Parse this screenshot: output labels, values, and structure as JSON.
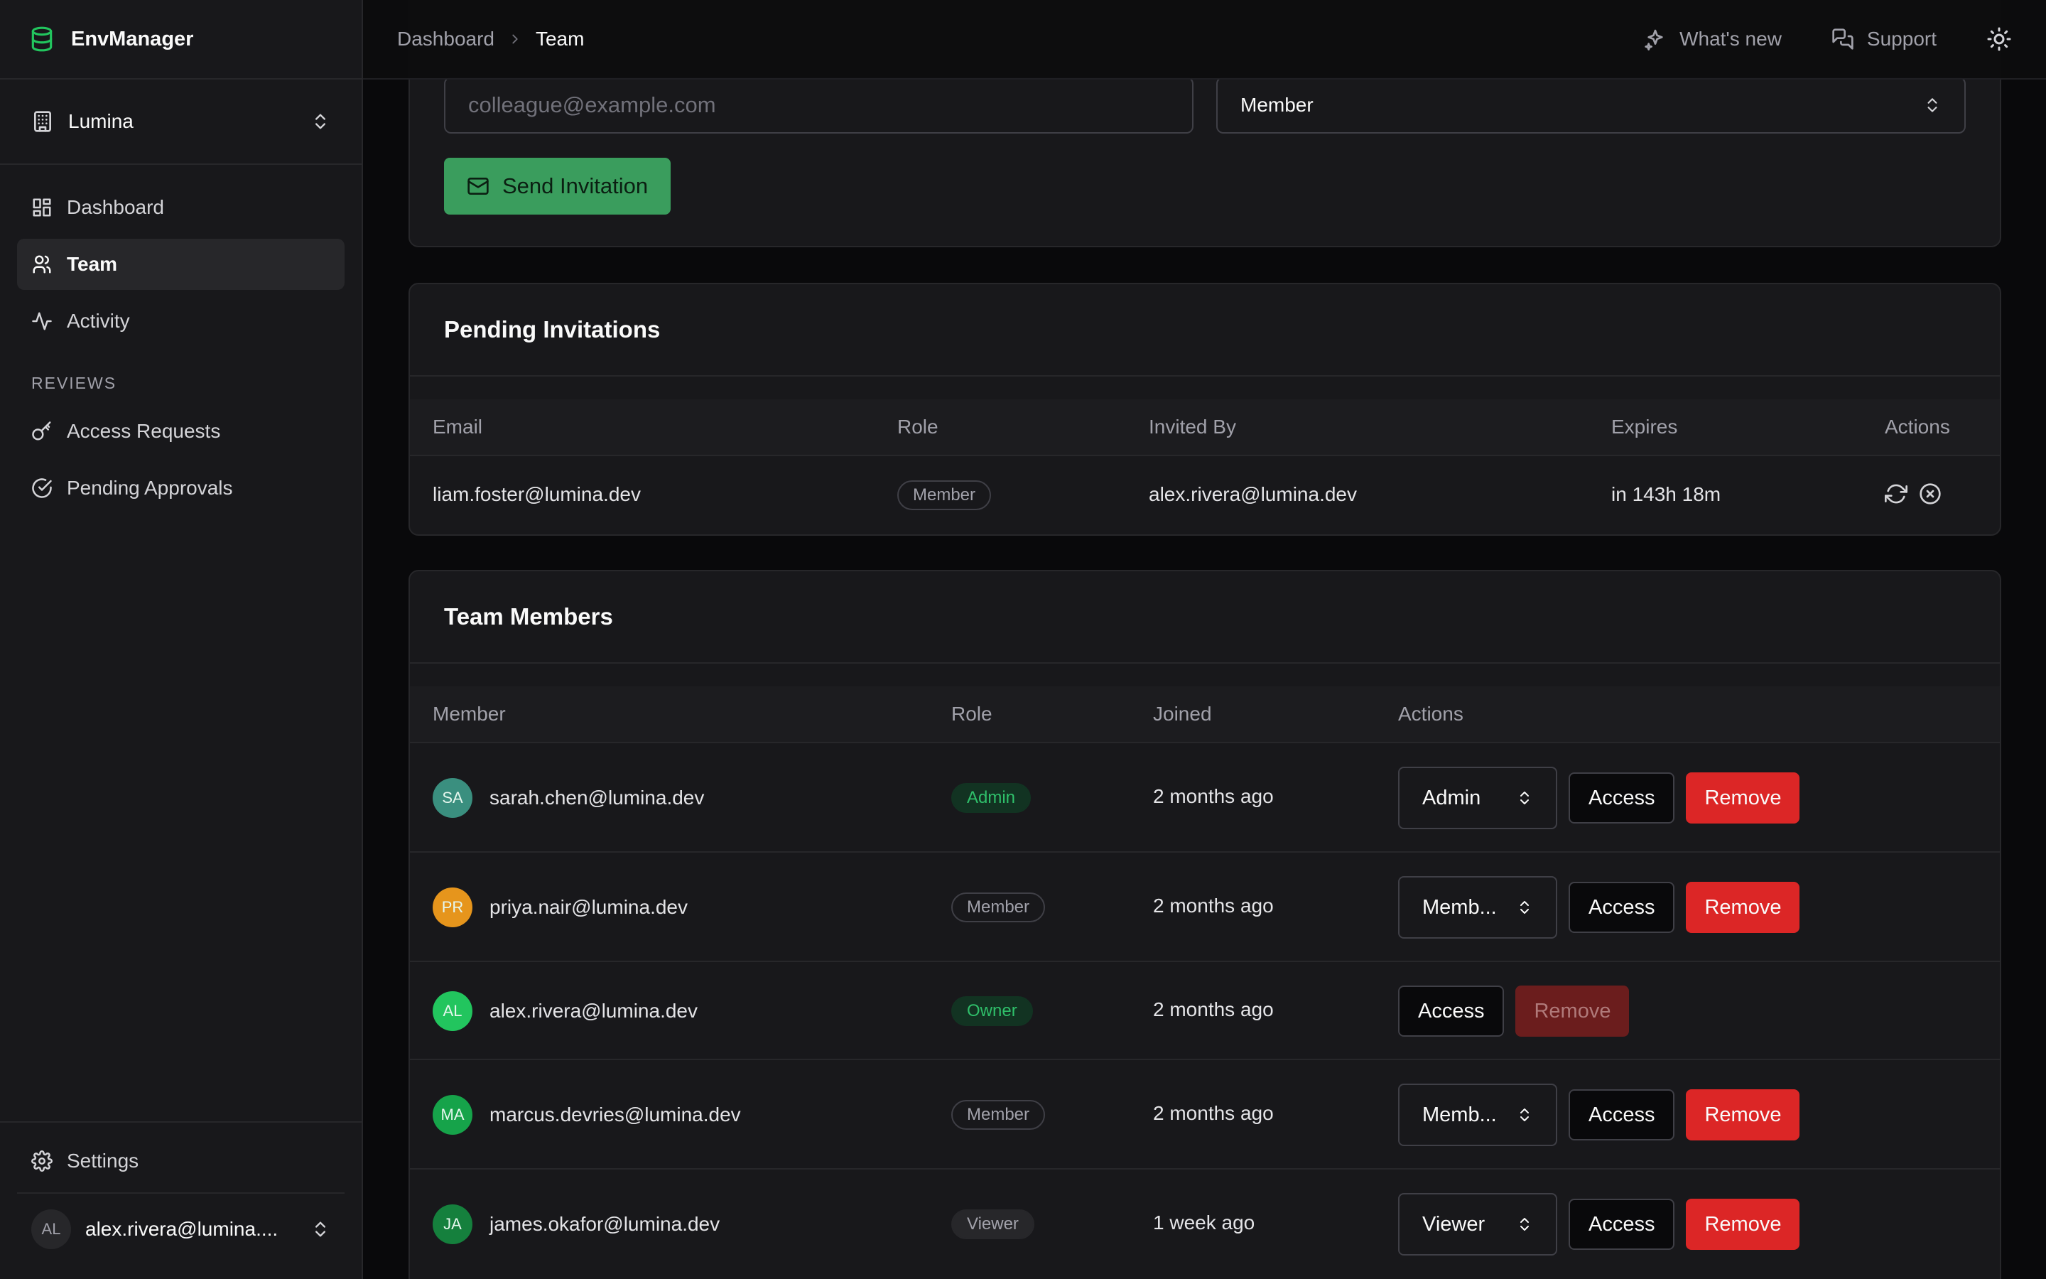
{
  "app": {
    "name": "EnvManager"
  },
  "org": {
    "name": "Lumina"
  },
  "nav": {
    "items": [
      {
        "label": "Dashboard",
        "icon": "dashboard-icon"
      },
      {
        "label": "Team",
        "icon": "users-icon",
        "active": true
      },
      {
        "label": "Activity",
        "icon": "activity-icon"
      }
    ],
    "section_label": "REVIEWS",
    "review_items": [
      {
        "label": "Access Requests",
        "icon": "key-icon"
      },
      {
        "label": "Pending Approvals",
        "icon": "check-circle-icon"
      }
    ],
    "settings_label": "Settings"
  },
  "user": {
    "initials": "AL",
    "email": "alex.rivera@lumina...."
  },
  "topbar": {
    "breadcrumb": [
      "Dashboard",
      "Team"
    ],
    "whats_new": "What's new",
    "support": "Support"
  },
  "invite": {
    "email_placeholder": "colleague@example.com",
    "role_value": "Member",
    "send_label": "Send Invitation"
  },
  "pending": {
    "title": "Pending Invitations",
    "columns": [
      "Email",
      "Role",
      "Invited By",
      "Expires",
      "Actions"
    ],
    "rows": [
      {
        "email": "liam.foster@lumina.dev",
        "role": "Member",
        "invited_by": "alex.rivera@lumina.dev",
        "expires": "in 143h 18m"
      }
    ]
  },
  "members": {
    "title": "Team Members",
    "columns": [
      "Member",
      "Role",
      "Joined",
      "Actions"
    ],
    "rows": [
      {
        "initials": "SA",
        "email": "sarah.chen@lumina.dev",
        "role": "Admin",
        "joined": "2 months ago",
        "select": "Admin",
        "access": "Access",
        "remove": "Remove",
        "avatar_color": "#3a8f7f"
      },
      {
        "initials": "PR",
        "email": "priya.nair@lumina.dev",
        "role": "Member",
        "joined": "2 months ago",
        "select": "Memb...",
        "access": "Access",
        "remove": "Remove",
        "avatar_color": "#e6951c"
      },
      {
        "initials": "AL",
        "email": "alex.rivera@lumina.dev",
        "role": "Owner",
        "joined": "2 months ago",
        "access": "Access",
        "remove": "Remove",
        "avatar_color": "#22c55e"
      },
      {
        "initials": "MA",
        "email": "marcus.devries@lumina.dev",
        "role": "Member",
        "joined": "2 months ago",
        "select": "Memb...",
        "access": "Access",
        "remove": "Remove",
        "avatar_color": "#16a34a"
      },
      {
        "initials": "JA",
        "email": "james.okafor@lumina.dev",
        "role": "Viewer",
        "joined": "1 week ago",
        "select": "Viewer",
        "access": "Access",
        "remove": "Remove",
        "avatar_color": "#15803d"
      }
    ]
  },
  "colors": {
    "accent": "#22c55e",
    "danger": "#dc2626",
    "send_button": "#3a9d5d"
  }
}
